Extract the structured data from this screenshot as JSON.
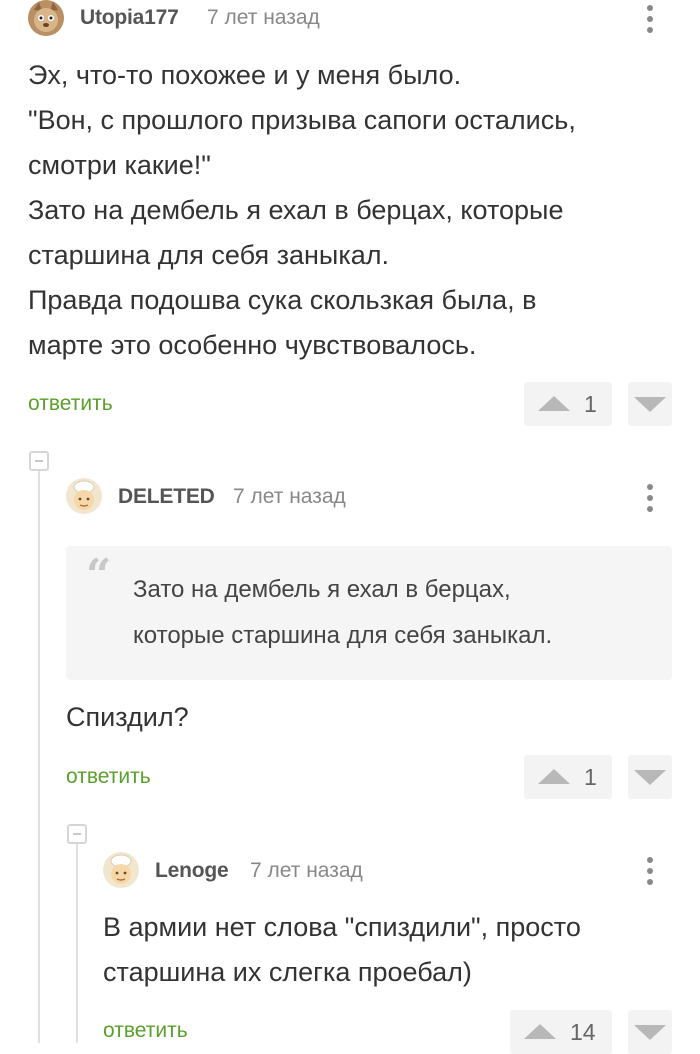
{
  "comments": [
    {
      "username": "Utopia177",
      "timestamp": "7 лет назад",
      "avatar_icon": "cat-face-avatar",
      "text_lines": [
        "Эх, что-то похожее и у меня было.",
        "\"Вон, с прошлого призыва сапоги остались,",
        "смотри какие!\"",
        "Зато на дембель я ехал в берцах, которые",
        "старшина для себя заныкал.",
        "Правда подошва сука скользкая была, в",
        "марте это особенно чувствовалось."
      ],
      "reply_label": "ответить",
      "rating": "1"
    },
    {
      "username": "DELETED",
      "timestamp": "7 лет назад",
      "avatar_icon": "default-chef-avatar",
      "quote_lines": [
        "Зато на дембель я ехал в берцах,",
        "которые старшина для себя заныкал."
      ],
      "text_lines": [
        "Спиздил?"
      ],
      "reply_label": "ответить",
      "rating": "1"
    },
    {
      "username": "Lenoge",
      "timestamp": "7 лет назад",
      "avatar_icon": "default-chef-avatar",
      "text_lines": [
        "В армии нет слова \"спиздили\", просто",
        "старшина их слегка проебал)"
      ],
      "reply_label": "ответить",
      "rating": "14"
    }
  ],
  "colors": {
    "reply_link": "#5aa02c",
    "vote_bg": "#f3f3f3",
    "vote_arrow": "#b8b8b8"
  }
}
